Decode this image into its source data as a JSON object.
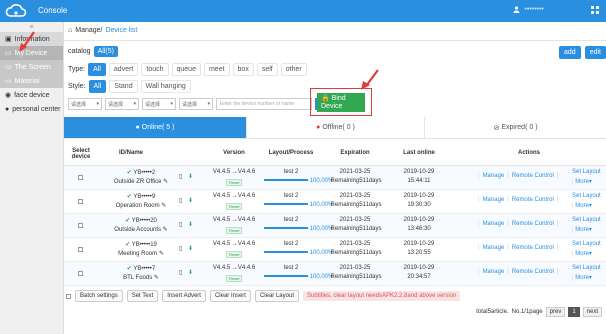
{
  "app": {
    "console_label": "Console",
    "user_name": "••••••••"
  },
  "sidebar": {
    "items": [
      {
        "label": "Information",
        "name": "sidebar-item-information"
      },
      {
        "label": "My Device",
        "name": "sidebar-item-my-device"
      },
      {
        "label": "The Screen",
        "name": "sidebar-item-the-screen"
      },
      {
        "label": "Material",
        "name": "sidebar-item-material"
      },
      {
        "label": "face device",
        "name": "sidebar-item-face-device"
      },
      {
        "label": "personal center",
        "name": "sidebar-item-personal-center"
      }
    ]
  },
  "breadcrumb": {
    "root": "Manage/",
    "current": "Device list"
  },
  "catalog": {
    "label": "catalog",
    "selected": "All(5)"
  },
  "actions": {
    "add": "add",
    "edit": "edit"
  },
  "type_filter": {
    "label": "Type:",
    "options": [
      "All",
      "advert",
      "touch",
      "queue",
      "meet",
      "box",
      "self",
      "other"
    ],
    "selected": "All"
  },
  "style_filter": {
    "label": "Style:",
    "options": [
      "All",
      "Stand",
      "Wall hanging"
    ],
    "selected": "All"
  },
  "filters": {
    "selects": [
      "请选择",
      "请选择",
      "请选择",
      "请选择"
    ],
    "search_placeholder": "Enter the device number or name"
  },
  "bind_button": {
    "label": "Bind Device"
  },
  "tabs": {
    "online": "Online( 5 )",
    "offline": "Offline( 0 )",
    "expired": "Expired( 0 )"
  },
  "table": {
    "headers": {
      "select": "Select device",
      "id": "ID/Name",
      "version": "Version",
      "layout": "Layout/Process",
      "expiration": "Expiration",
      "last_online": "Last online",
      "actions": "Actions"
    },
    "rows": [
      {
        "id": "YB•••••2",
        "name": "Outside ZR Office",
        "version": "V4.4.5 →V4.4.6",
        "version_badge": "Reset",
        "layout": "test 2",
        "progress": "100.00%",
        "expiration": "2021-03-25",
        "remaining": "Remaining511days",
        "last_date": "2019-10-29",
        "last_time": "15:44:11"
      },
      {
        "id": "YB•••••9",
        "name": "Operation Room",
        "version": "V4.4.5 →V4.4.6",
        "version_badge": "Reset",
        "layout": "test 2",
        "progress": "100.00%",
        "expiration": "2021-03-25",
        "remaining": "Remaining511days",
        "last_date": "2019-10-29",
        "last_time": "19:30:30"
      },
      {
        "id": "YB•••••20",
        "name": "Outside Accounts",
        "version": "V4.4.5 →V4.4.6",
        "version_badge": "Reset",
        "layout": "test 2",
        "progress": "100.00%",
        "expiration": "2021-03-25",
        "remaining": "Remaining511days",
        "last_date": "2019-10-29",
        "last_time": "13:46:30"
      },
      {
        "id": "YB•••••19",
        "name": "Meeting Room",
        "version": "V4.4.5 →V4.4.6",
        "version_badge": "Reset",
        "layout": "test 2",
        "progress": "100.00%",
        "expiration": "2021-03-25",
        "remaining": "Remaining511days",
        "last_date": "2019-10-29",
        "last_time": "13:20:55"
      },
      {
        "id": "YB•••••7",
        "name": "BTL Foods",
        "version": "V4.4.5 →V4.4.6",
        "version_badge": "Reset",
        "layout": "test 2",
        "progress": "100.00%",
        "expiration": "2021-03-25",
        "remaining": "Remaining511days",
        "last_date": "2019-10-29",
        "last_time": "20:34:57"
      }
    ],
    "row_actions": {
      "manage": "Manage",
      "remote": "Remote Control",
      "set_layout": "Set Layout",
      "more": "More▾"
    }
  },
  "bulk": {
    "batch": "Batch settings",
    "set_text": "Set Text",
    "insert_advert": "Insert Advert",
    "clear_insert": "Clear Insert",
    "clear_layout": "Clear Layout",
    "warning": "Subtitles, clear layout needsAPK2.2.8and above version"
  },
  "pager": {
    "total": "total5article.",
    "page_info": "No.1/1page",
    "prev": "prev",
    "current": "1",
    "next": "next"
  },
  "colors": {
    "accent": "#2b8fe0",
    "bind_green": "#32a853",
    "highlight_red": "#e03c3c"
  }
}
